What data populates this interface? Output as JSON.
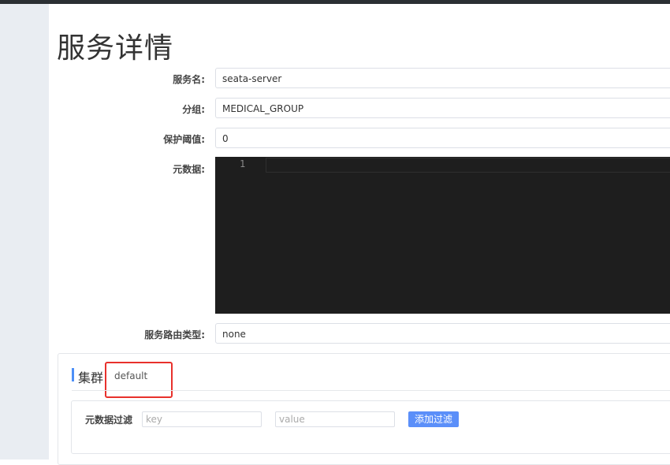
{
  "page": {
    "title": "服务详情"
  },
  "form": {
    "service_name": {
      "label": "服务名:",
      "value": "seata-server"
    },
    "group": {
      "label": "分组:",
      "value": "MEDICAL_GROUP"
    },
    "protect_threshold": {
      "label": "保护阈值:",
      "value": "0"
    },
    "metadata": {
      "label": "元数据:",
      "line_number": "1"
    },
    "route_type": {
      "label": "服务路由类型:",
      "value": "none"
    }
  },
  "cluster": {
    "label": "集群",
    "name": "default",
    "filter": {
      "label": "元数据过滤",
      "key_placeholder": "key",
      "value_placeholder": "value",
      "add_button": "添加过滤"
    }
  },
  "colors": {
    "accent": "#5b8ff9",
    "highlight": "#e8312c",
    "editor_bg": "#1e1e1e"
  }
}
